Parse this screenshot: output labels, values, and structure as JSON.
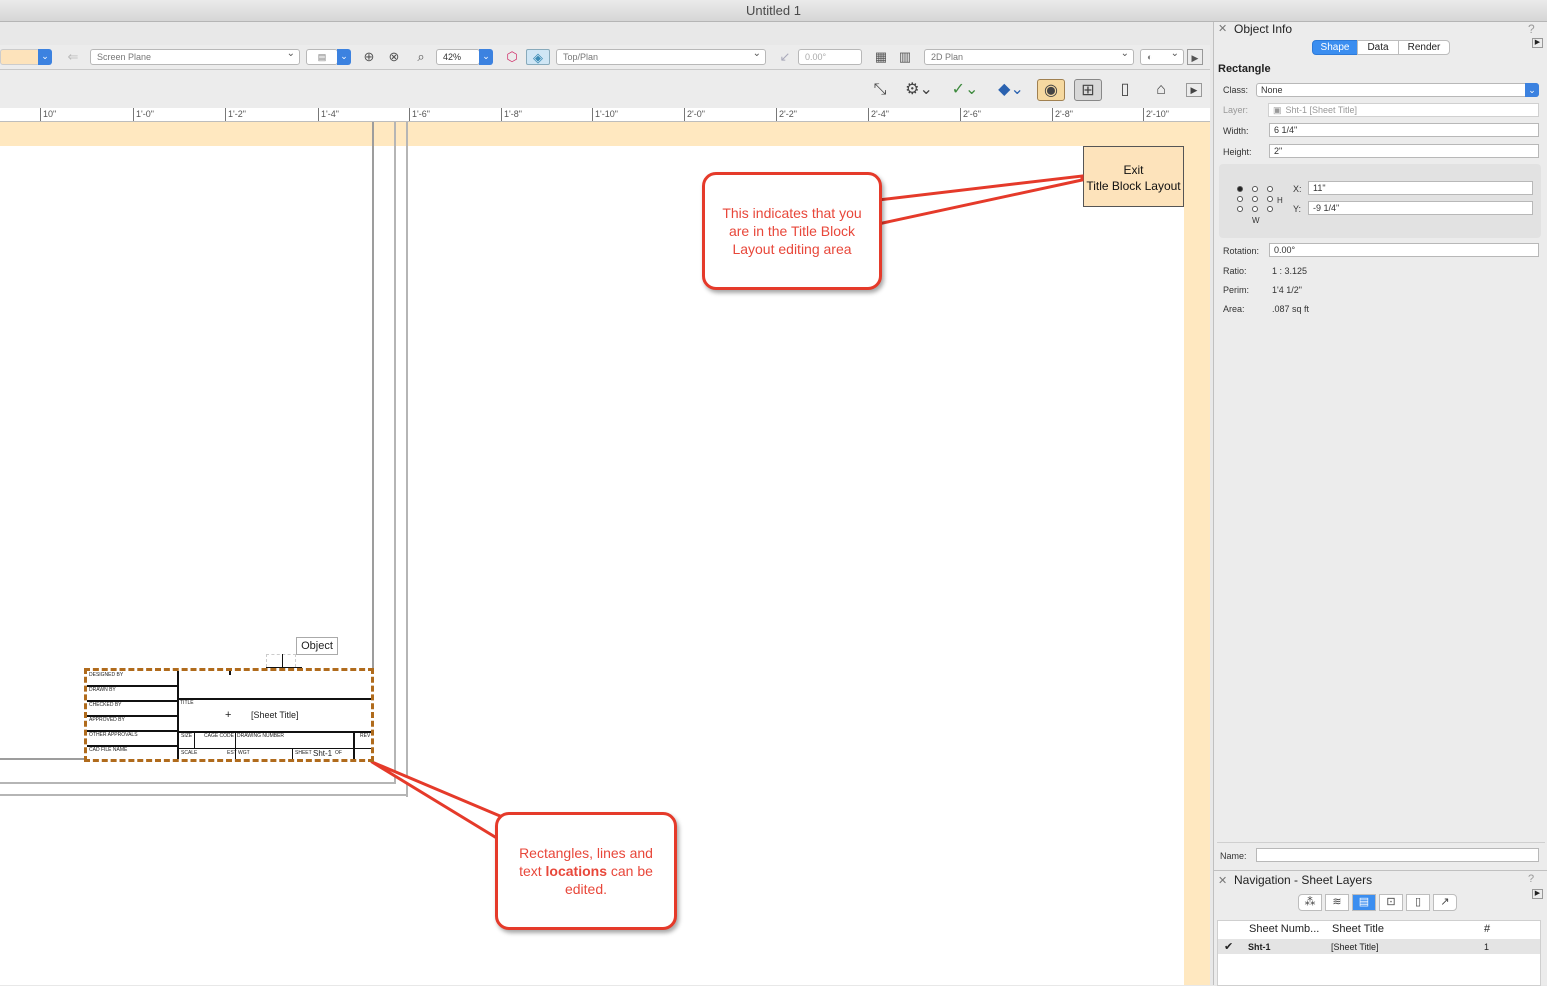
{
  "window": {
    "title": "Untitled 1"
  },
  "viewbar": {
    "plane": "Screen Plane",
    "zoom": "42%",
    "view": "Top/Plan",
    "rotation": "0.00°",
    "render": "2D Plan"
  },
  "ruler": {
    "ticks": [
      "10\"",
      "1'-0\"",
      "1'-2\"",
      "1'-4\"",
      "1'-6\"",
      "1'-8\"",
      "1'-10\"",
      "2'-0\"",
      "2'-2\"",
      "2'-4\"",
      "2'-6\"",
      "2'-8\"",
      "2'-10\""
    ]
  },
  "canvas": {
    "exit_button": {
      "line1": "Exit",
      "line2": "Title Block Layout"
    },
    "callout_top": "This indicates that you are in the Title Block Layout editing area",
    "callout_bottom": {
      "pre": "Rectangles, lines and text ",
      "bold": "locations",
      "post": " can be edited."
    },
    "object_tag": "Object",
    "title_block": {
      "sheet_title": "[Sheet Title]",
      "sheet_number": "Sht-1",
      "labels": [
        "DESIGNED BY",
        "DRAWN BY",
        "CHECKED BY",
        "APPROVED BY",
        "OTHER APPROVALS",
        "CAD FILE NAME",
        "TITLE",
        "SIZE",
        "CAGE CODE",
        "DRAWING NUMBER",
        "REV",
        "SCALE",
        "EST WGT",
        "SHEET",
        "OF"
      ]
    }
  },
  "object_info": {
    "title": "Object Info",
    "tabs": [
      "Shape",
      "Data",
      "Render"
    ],
    "object_type": "Rectangle",
    "class_label": "Class:",
    "class_value": "None",
    "layer_label": "Layer:",
    "layer_value": "Sht-1 [Sheet Title]",
    "width_label": "Width:",
    "width_value": "6 1/4\"",
    "height_label": "Height:",
    "height_value": "2\"",
    "x_label": "X:",
    "x_value": "11\"",
    "y_label": "Y:",
    "y_value": "-9 1/4\"",
    "h_label": "H",
    "w_label": "W",
    "rotation_label": "Rotation:",
    "rotation_value": "0.00°",
    "ratio_label": "Ratio:",
    "ratio_value": "1 : 3.125",
    "perim_label": "Perim:",
    "perim_value": "1'4 1/2\"",
    "area_label": "Area:",
    "area_value": ".087 sq ft",
    "name_label": "Name:",
    "name_value": ""
  },
  "navigation": {
    "title": "Navigation - Sheet Layers",
    "columns": [
      "Sheet Numb...",
      "Sheet Title",
      "#"
    ],
    "rows": [
      {
        "number": "Sht-1",
        "title": "[Sheet Title]",
        "count": "1"
      }
    ]
  }
}
